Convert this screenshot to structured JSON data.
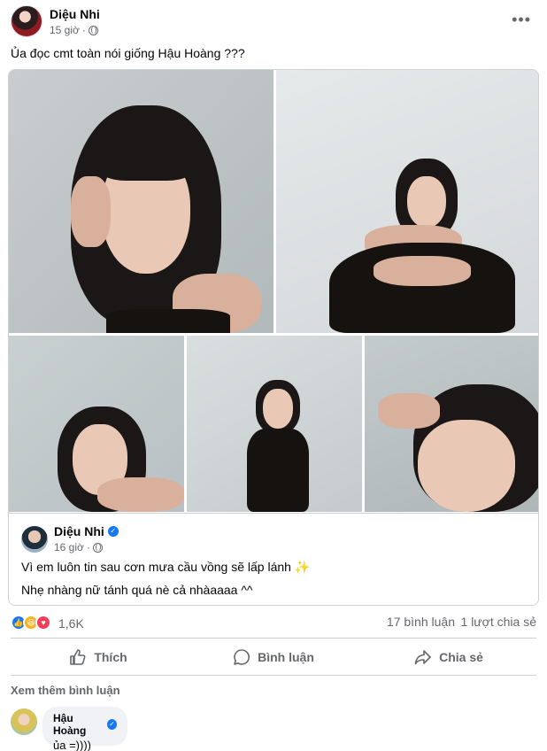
{
  "post": {
    "author": "Diệu Nhi",
    "time": "15 giờ",
    "caption": "Ủa đọc cmt toàn nói giống Hậu Hoàng ???",
    "more_icon": "•••"
  },
  "shared": {
    "author": "Diệu Nhi",
    "time": "16 giờ",
    "line1": "Vì em luôn tin sau cơn mưa cầu vồng sẽ lấp lánh ✨",
    "line2": "Nhẹ nhàng nữ tánh quá nè cả nhàaaaa ^^"
  },
  "stats": {
    "reactions": "1,6K",
    "reaction_icons": [
      "like-icon",
      "haha-icon",
      "love-icon"
    ],
    "comments": "17 bình luận",
    "shares": "1 lượt chia sẻ"
  },
  "actions": {
    "like": "Thích",
    "comment": "Bình luận",
    "share": "Chia sẻ"
  },
  "more_comments": "Xem thêm bình luận",
  "comment": {
    "author": "Hậu Hoàng",
    "text": "ủa =))))"
  },
  "colors": {
    "accent": "#1877f2",
    "secondary_text": "#65676b",
    "divider": "#ced0d4"
  }
}
